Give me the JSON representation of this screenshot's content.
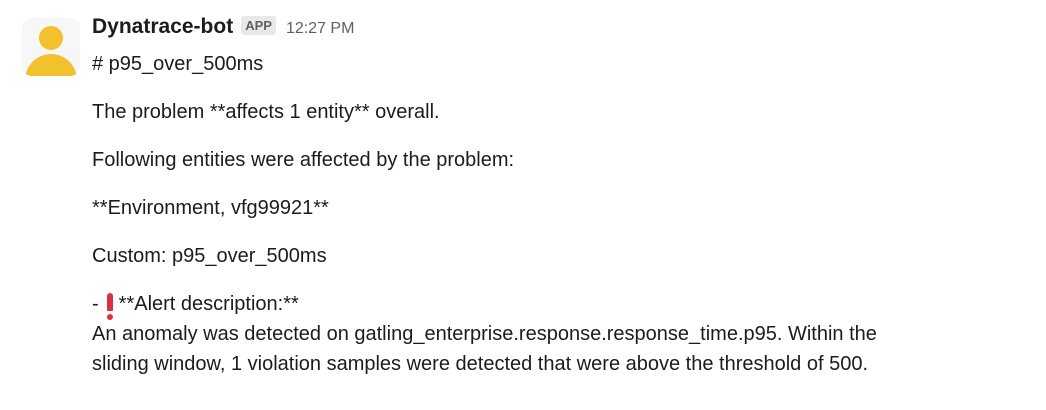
{
  "message": {
    "sender": "Dynatrace-bot",
    "badge": "APP",
    "time": "12:27 PM",
    "heading": "# p95_over_500ms",
    "line1": "The problem **affects 1 entity** overall.",
    "line2": "Following entities were affected by the problem:",
    "line3": "**Environment, vfg99921**",
    "line4": "Custom: p95_over_500ms",
    "alert_prefix": "-",
    "alert_label": "**Alert description:**",
    "description_line1": "An anomaly was detected on gatling_enterprise.response.response_time.p95. Within the",
    "description_line2": "sliding window, 1 violation samples were detected that were above the threshold of 500."
  },
  "icons": {
    "avatar": "user-avatar-icon",
    "alert": "exclamation-icon",
    "alert_color": "#dd2e44",
    "avatar_color": "#f2c12e"
  }
}
